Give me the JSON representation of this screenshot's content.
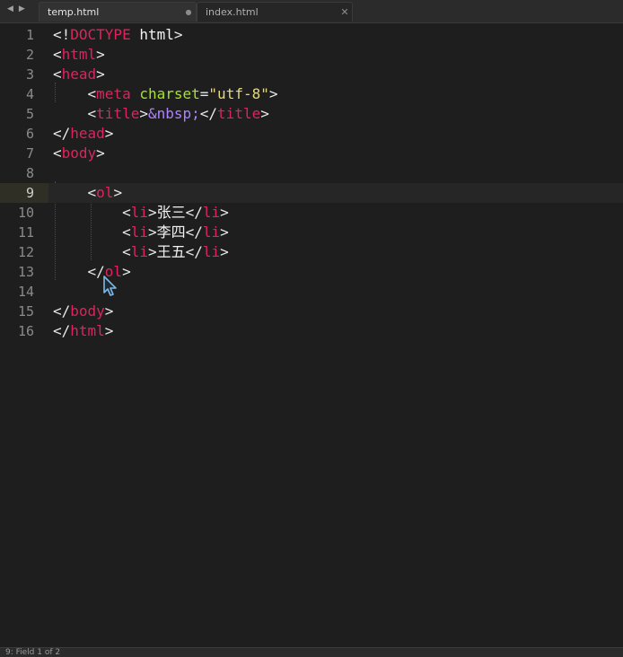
{
  "tabs": [
    {
      "label": "temp.html",
      "active": true,
      "control": "●"
    },
    {
      "label": "index.html",
      "active": false,
      "control": "✕"
    }
  ],
  "nav": {
    "back": "◀",
    "forward": "▶"
  },
  "editor": {
    "current_line": 9,
    "lines": [
      {
        "num": "1",
        "tokens": [
          [
            "br",
            "<!"
          ],
          [
            "tg",
            "DOCTYPE"
          ],
          [
            "tx",
            " html"
          ],
          [
            "br",
            ">"
          ]
        ]
      },
      {
        "num": "2",
        "tokens": [
          [
            "br",
            "<"
          ],
          [
            "tg",
            "html"
          ],
          [
            "br",
            ">"
          ]
        ]
      },
      {
        "num": "3",
        "tokens": [
          [
            "br",
            "<"
          ],
          [
            "tg",
            "head"
          ],
          [
            "br",
            ">"
          ]
        ]
      },
      {
        "num": "4",
        "tokens": [
          [
            "tx",
            "    "
          ],
          [
            "br",
            "<"
          ],
          [
            "tg",
            "meta"
          ],
          [
            "tx",
            " "
          ],
          [
            "at",
            "charset"
          ],
          [
            "br",
            "="
          ],
          [
            "st",
            "\"utf-8\""
          ],
          [
            "br",
            ">"
          ]
        ]
      },
      {
        "num": "5",
        "tokens": [
          [
            "tx",
            "    "
          ],
          [
            "br",
            "<"
          ],
          [
            "tg",
            "title"
          ],
          [
            "br",
            ">"
          ],
          [
            "en",
            "&nbsp;"
          ],
          [
            "br",
            "</"
          ],
          [
            "tg",
            "title"
          ],
          [
            "br",
            ">"
          ]
        ]
      },
      {
        "num": "6",
        "tokens": [
          [
            "br",
            "</"
          ],
          [
            "tg",
            "head"
          ],
          [
            "br",
            ">"
          ]
        ]
      },
      {
        "num": "7",
        "tokens": [
          [
            "br",
            "<"
          ],
          [
            "tg",
            "body"
          ],
          [
            "br",
            ">"
          ]
        ]
      },
      {
        "num": "8",
        "tokens": []
      },
      {
        "num": "9",
        "tokens": [
          [
            "tx",
            "    "
          ],
          [
            "br",
            "<"
          ],
          [
            "tg",
            "ol"
          ],
          [
            "br",
            ">"
          ]
        ]
      },
      {
        "num": "10",
        "tokens": [
          [
            "tx",
            "        "
          ],
          [
            "br",
            "<"
          ],
          [
            "tg",
            "li"
          ],
          [
            "br",
            ">"
          ],
          [
            "tx",
            "张三"
          ],
          [
            "br",
            "</"
          ],
          [
            "tg",
            "li"
          ],
          [
            "br",
            ">"
          ]
        ]
      },
      {
        "num": "11",
        "tokens": [
          [
            "tx",
            "        "
          ],
          [
            "br",
            "<"
          ],
          [
            "tg",
            "li"
          ],
          [
            "br",
            ">"
          ],
          [
            "tx",
            "李四"
          ],
          [
            "br",
            "</"
          ],
          [
            "tg",
            "li"
          ],
          [
            "br",
            ">"
          ]
        ]
      },
      {
        "num": "12",
        "tokens": [
          [
            "tx",
            "        "
          ],
          [
            "br",
            "<"
          ],
          [
            "tg",
            "li"
          ],
          [
            "br",
            ">"
          ],
          [
            "tx",
            "王五"
          ],
          [
            "br",
            "</"
          ],
          [
            "tg",
            "li"
          ],
          [
            "br",
            ">"
          ]
        ]
      },
      {
        "num": "13",
        "tokens": [
          [
            "tx",
            "    "
          ],
          [
            "br",
            "</"
          ],
          [
            "tg",
            "ol"
          ],
          [
            "br",
            ">"
          ]
        ]
      },
      {
        "num": "14",
        "tokens": []
      },
      {
        "num": "15",
        "tokens": [
          [
            "br",
            "</"
          ],
          [
            "tg",
            "body"
          ],
          [
            "br",
            ">"
          ]
        ]
      },
      {
        "num": "16",
        "tokens": [
          [
            "br",
            "</"
          ],
          [
            "tg",
            "html"
          ],
          [
            "br",
            ">"
          ]
        ]
      }
    ]
  },
  "status": {
    "text": "9:  Field 1 of 2"
  },
  "colors": {
    "background": "#1e1e1e",
    "tag": "#e0225e",
    "attribute": "#a6e22e",
    "string": "#e6db74",
    "entity": "#ae81ff",
    "text": "#f2f2f2"
  },
  "icons": {
    "mouse_cursor": "arrow-cursor-icon"
  }
}
